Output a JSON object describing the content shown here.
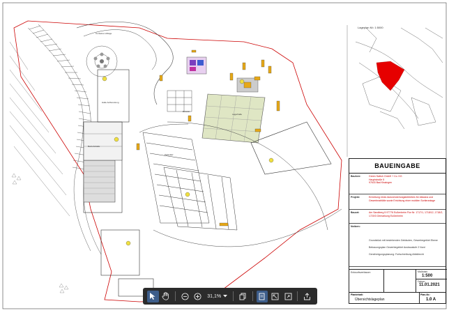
{
  "drawing": {
    "location_title": "Lageplan M= 1:5000",
    "labels": {
      "container_area": "Container-Ablage",
      "entrance": "Einfahrt",
      "hall": "Halle Aufbereitung",
      "bin1": "Betriebshalle",
      "lager": "Lagerhalle",
      "parking": "Parkplatz"
    }
  },
  "titleblock": {
    "heading": "BAUEINGABE",
    "bauherr_key": "Bauherr:",
    "bauherr_val": "Green Switch GmbH + Co. KG\nHauptstraße 5\n97633 Bad Kissingen",
    "projekt_key": "Projekt:",
    "projekt_val": "Errichtung eines Autoverwertungsbetriebes für Altautos und Gewerbeabfälle sowie Errichtung einer mobilen Sortieranlage",
    "bauort_key": "Bauort:",
    "bauort_val": "Am Sandberg 5 97776 Eußenheim Flur Nr. 1717/1, 1718/12, 1718/2, 1720/3 Gemarkung Eußenheim",
    "notes_key": "Notizen:",
    "note1": "Grundstück mit bestehenden Gebäuden, Gewerbegebiet Ebene",
    "note2": "Bebauungsplan Gewerbegebiet Ausbaustufe 2 Nord",
    "note3": "Genehmigungsplanung: Fortschreibung Abfallrecht",
    "plan_key": "Planinhalt:",
    "plan_val": "Übersichtslageplan",
    "massstab_key": "Maßstab:",
    "massstab_val": "1:500",
    "datum_key": "Datum:",
    "datum_val": "11.01.2021",
    "planNr_key": "Plan-Nr.:",
    "planNr_val": "1.0 A",
    "schreiber_key": "Entwurfsverfasser:"
  },
  "toolbar": {
    "zoom_value": "31,1%",
    "pointer_icon": "pointer-icon",
    "hand_icon": "hand-icon"
  }
}
